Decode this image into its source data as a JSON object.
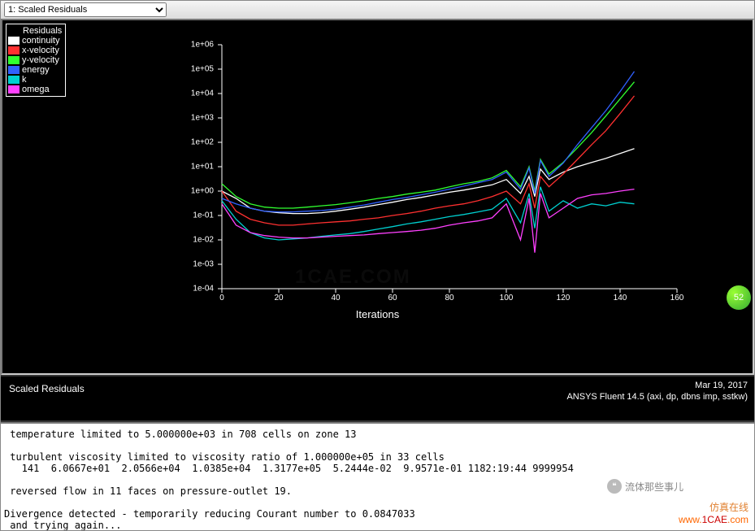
{
  "toolbar": {
    "dropdown_selected": "1: Scaled Residuals"
  },
  "legend": {
    "title": "Residuals",
    "items": [
      {
        "label": "continuity",
        "color": "#ffffff"
      },
      {
        "label": "x-velocity",
        "color": "#ff3030"
      },
      {
        "label": "y-velocity",
        "color": "#30ff30"
      },
      {
        "label": "energy",
        "color": "#3060ff"
      },
      {
        "label": "k",
        "color": "#00d0d0"
      },
      {
        "label": "omega",
        "color": "#ff40ff"
      }
    ]
  },
  "chart_data": {
    "type": "line",
    "xlabel": "Iterations",
    "ylabel": "",
    "xlim": [
      0,
      160
    ],
    "ylim": [
      0.0001,
      1000000.0
    ],
    "x_ticks": [
      0,
      20,
      40,
      60,
      80,
      100,
      120,
      140,
      160
    ],
    "y_ticks": [
      "1e+06",
      "1e+05",
      "1e+04",
      "1e+03",
      "1e+02",
      "1e+01",
      "1e+00",
      "1e-01",
      "1e-02",
      "1e-03",
      "1e-04"
    ],
    "x": [
      0,
      5,
      10,
      15,
      20,
      25,
      30,
      35,
      40,
      45,
      50,
      55,
      60,
      65,
      70,
      75,
      80,
      85,
      90,
      95,
      100,
      105,
      108,
      110,
      112,
      115,
      120,
      125,
      130,
      135,
      140,
      145
    ],
    "series": [
      {
        "name": "continuity",
        "color": "#ffffff",
        "values": [
          1,
          0.5,
          0.2,
          0.15,
          0.13,
          0.12,
          0.12,
          0.13,
          0.15,
          0.18,
          0.22,
          0.28,
          0.35,
          0.45,
          0.55,
          0.7,
          0.9,
          1.1,
          1.4,
          1.8,
          3,
          0.8,
          4,
          0.6,
          8,
          3,
          6,
          10,
          15,
          22,
          35,
          55
        ]
      },
      {
        "name": "x-velocity",
        "color": "#ff3030",
        "values": [
          1,
          0.15,
          0.07,
          0.05,
          0.04,
          0.04,
          0.045,
          0.05,
          0.055,
          0.06,
          0.07,
          0.08,
          0.1,
          0.12,
          0.15,
          0.2,
          0.25,
          0.3,
          0.4,
          0.6,
          1,
          0.3,
          2,
          0.2,
          4,
          1.5,
          5,
          20,
          80,
          300,
          1500,
          8000
        ]
      },
      {
        "name": "y-velocity",
        "color": "#30ff30",
        "values": [
          2,
          0.6,
          0.3,
          0.22,
          0.2,
          0.2,
          0.22,
          0.25,
          0.28,
          0.33,
          0.4,
          0.5,
          0.6,
          0.75,
          0.9,
          1.1,
          1.5,
          2,
          2.5,
          3.5,
          7,
          1.5,
          10,
          1,
          20,
          5,
          15,
          60,
          250,
          1200,
          6000,
          30000
        ]
      },
      {
        "name": "energy",
        "color": "#3060ff",
        "values": [
          0.5,
          0.3,
          0.2,
          0.15,
          0.14,
          0.14,
          0.15,
          0.16,
          0.18,
          0.22,
          0.27,
          0.35,
          0.45,
          0.55,
          0.7,
          0.9,
          1.2,
          1.6,
          2.2,
          3,
          6,
          1.2,
          9,
          0.8,
          18,
          4,
          14,
          80,
          400,
          2000,
          12000,
          80000
        ]
      },
      {
        "name": "k",
        "color": "#00d0d0",
        "values": [
          0.4,
          0.07,
          0.02,
          0.012,
          0.01,
          0.011,
          0.012,
          0.014,
          0.016,
          0.018,
          0.022,
          0.028,
          0.035,
          0.045,
          0.055,
          0.07,
          0.09,
          0.11,
          0.14,
          0.18,
          0.5,
          0.05,
          0.8,
          0.03,
          1.5,
          0.15,
          0.4,
          0.2,
          0.3,
          0.25,
          0.35,
          0.3
        ]
      },
      {
        "name": "omega",
        "color": "#ff40ff",
        "values": [
          0.3,
          0.04,
          0.02,
          0.015,
          0.013,
          0.012,
          0.012,
          0.013,
          0.014,
          0.015,
          0.016,
          0.018,
          0.02,
          0.022,
          0.025,
          0.03,
          0.04,
          0.05,
          0.06,
          0.08,
          0.3,
          0.01,
          0.5,
          0.003,
          0.8,
          0.08,
          0.2,
          0.5,
          0.7,
          0.8,
          1,
          1.2
        ]
      }
    ]
  },
  "footer": {
    "left": "Scaled Residuals",
    "date": "Mar 19, 2017",
    "version": "ANSYS Fluent 14.5 (axi, dp, dbns imp, sstkw)"
  },
  "console": {
    "text": " temperature limited to 5.000000e+03 in 708 cells on zone 13\n\n turbulent viscosity limited to viscosity ratio of 1.000000e+05 in 33 cells\n   141  6.0667e+01  2.0566e+04  1.0385e+04  1.3177e+05  5.2444e-02  9.9571e-01 1182:19:44 9999954\n\n reversed flow in 11 faces on pressure-outlet 19.\n\nDivergence detected - temporarily reducing Courant number to 0.0847033\n and trying again..."
  },
  "watermark": "1CAE.COM",
  "badge": "52",
  "branding": {
    "line1": "仿真在线",
    "url": "www.1CAE.com"
  },
  "wechat": "流体那些事儿"
}
